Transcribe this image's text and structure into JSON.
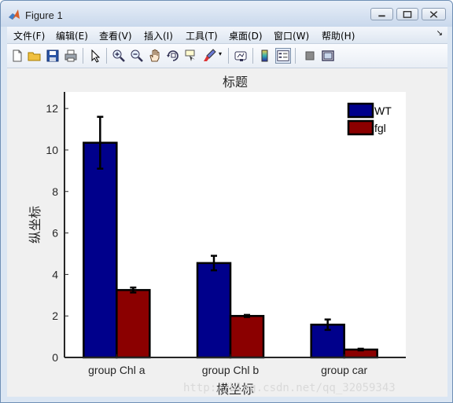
{
  "window": {
    "title": "Figure 1",
    "accent": "#c9d8ec"
  },
  "menu": [
    "文件(F)",
    "编辑(E)",
    "查看(V)",
    "插入(I)",
    "工具(T)",
    "桌面(D)",
    "窗口(W)",
    "帮助(H)"
  ],
  "toolbar": {
    "icons": [
      "new-figure-icon",
      "open-file-icon",
      "save-icon",
      "print-icon",
      "pointer-icon",
      "zoom-in-icon",
      "zoom-out-icon",
      "pan-icon",
      "rotate-3d-icon",
      "data-cursor-icon",
      "brush-icon",
      "link-plot-icon",
      "colorbar-icon",
      "legend-icon",
      "hide-plot-tools-icon",
      "show-plot-tools-icon"
    ]
  },
  "chart_data": {
    "type": "bar",
    "title": "标题",
    "xlabel": "横坐标",
    "ylabel": "纵坐标",
    "categories": [
      "group Chl a",
      "group Chl b",
      "group car"
    ],
    "series": [
      {
        "name": "WT",
        "values": [
          10.35,
          4.55,
          1.58
        ],
        "errors": [
          1.25,
          0.35,
          0.25
        ],
        "color": "#00008b"
      },
      {
        "name": "fgl",
        "values": [
          3.25,
          2.0,
          0.38
        ],
        "errors": [
          0.12,
          0.05,
          0.04
        ],
        "color": "#8b0000"
      }
    ],
    "ylim": [
      0,
      12.8
    ],
    "yticks": [
      0,
      2,
      4,
      6,
      8,
      10,
      12
    ],
    "legend": "top-right",
    "grid": false
  },
  "watermark": "http://blog.csdn.net/qq_32059343"
}
